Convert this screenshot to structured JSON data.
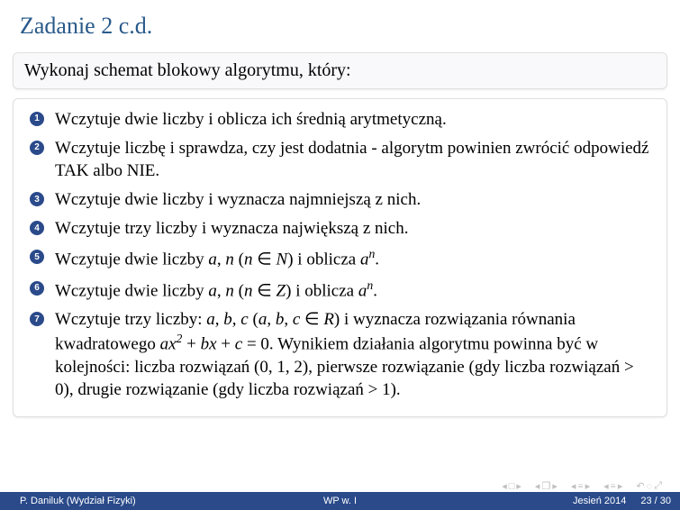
{
  "title": "Zadanie 2 c.d.",
  "block_text": "Wykonaj schemat blokowy algorytmu, który:",
  "items": [
    {
      "html": "Wczytuje dwie liczby i oblicza ich średnią arytmetyczną."
    },
    {
      "html": "Wczytuje liczbę i sprawdza, czy jest dodatnia - algorytm powinien zwrócić odpowiedź TAK albo NIE."
    },
    {
      "html": "Wczytuje dwie liczby i wyznacza najmniejszą z nich."
    },
    {
      "html": "Wczytuje trzy liczby i wyznacza największą z nich."
    },
    {
      "html": "Wczytuje dwie liczby <span class='it'>a</span>, <span class='it'>n</span> (<span class='it'>n</span> ∈ <span class='it'>N</span>) i oblicza <span class='it'>a</span><span class='sup'>n</span>."
    },
    {
      "html": "Wczytuje dwie liczby <span class='it'>a</span>, <span class='it'>n</span> (<span class='it'>n</span> ∈ <span class='it'>Z</span>) i oblicza <span class='it'>a</span><span class='sup'>n</span>."
    },
    {
      "html": "Wczytuje trzy liczby: <span class='it'>a</span>, <span class='it'>b</span>, <span class='it'>c</span> (<span class='it'>a</span>, <span class='it'>b</span>, <span class='it'>c</span> ∈ <span class='it'>R</span>) i wyznacza rozwiązania równania kwadratowego <span class='it'>ax</span><span class='sup'>2</span> + <span class='it'>bx</span> + <span class='it'>c</span> = 0. Wynikiem działania algorytmu powinna być w kolejności: liczba rozwiązań (0, 1, 2), pierwsze rozwiązanie (gdy liczba rozwiązań &gt; 0), drugie rozwiązanie (gdy liczba rozwiązań &gt; 1)."
    }
  ],
  "footer": {
    "left": "P. Daniluk (Wydział Fizyki)",
    "mid": "WP w. I",
    "term": "Jesień 2014",
    "page": "23 / 30"
  }
}
